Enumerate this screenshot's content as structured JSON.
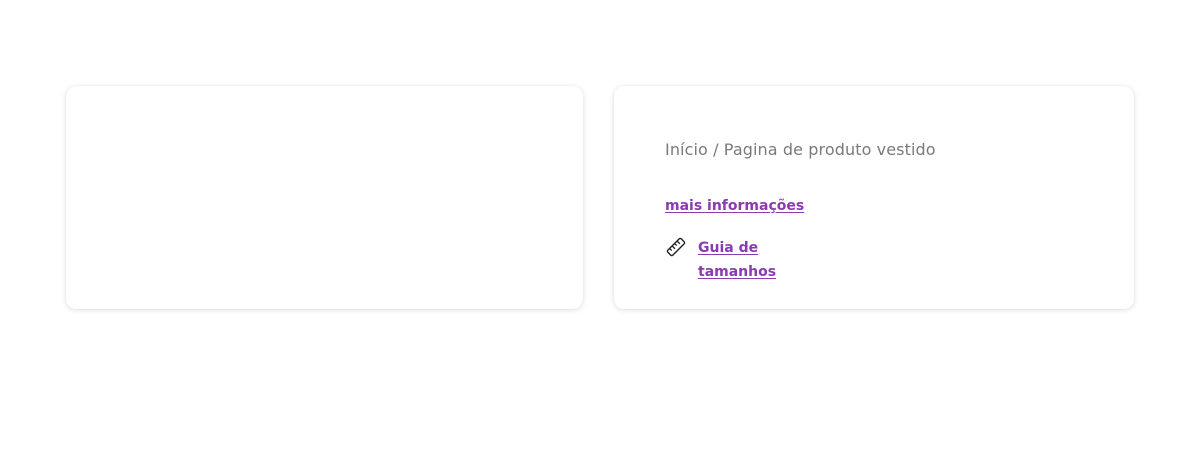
{
  "breadcrumb": {
    "text": "Início / Pagina de produto vestido"
  },
  "product": {
    "more_info_label": "mais informações",
    "size_guide_label": "Guia de tamanhos",
    "size_guide_icon": "ruler-icon"
  },
  "colors": {
    "link": "#8a3bb0",
    "breadcrumb": "#7a7a7a"
  }
}
